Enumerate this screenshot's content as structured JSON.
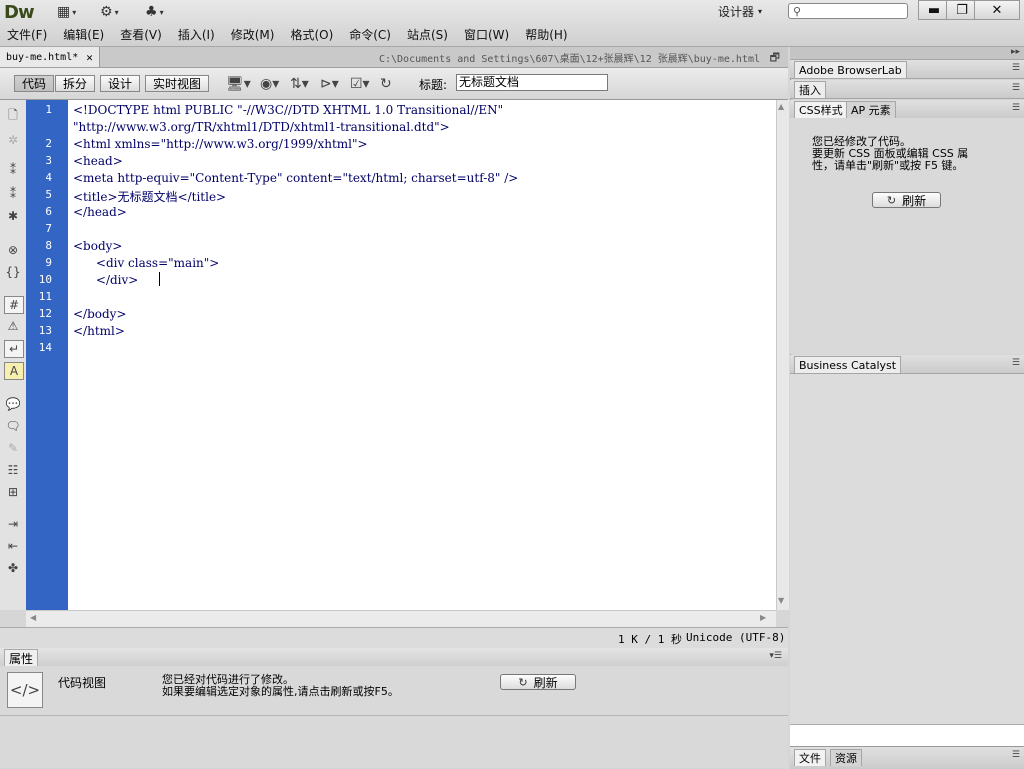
{
  "app": {
    "logo": "Dw"
  },
  "topbar": {
    "workspace_label": "设计器",
    "window_buttons": [
      "minimize-icon",
      "restore-icon",
      "close-icon"
    ]
  },
  "menu": [
    "文件(F)",
    "编辑(E)",
    "查看(V)",
    "插入(I)",
    "修改(M)",
    "格式(O)",
    "命令(C)",
    "站点(S)",
    "窗口(W)",
    "帮助(H)"
  ],
  "document": {
    "tab_name": "buy-me.html*",
    "path": "C:\\Documents and Settings\\607\\桌面\\12+张晨辉\\12 张晨辉\\buy-me.html"
  },
  "toolbar": {
    "views": [
      "代码",
      "拆分",
      "设计",
      "实时视图"
    ],
    "active_view": "代码",
    "title_label": "标题:",
    "title_value": "无标题文档"
  },
  "code": {
    "line_numbers": [
      "1",
      "2",
      "3",
      "4",
      "5",
      "6",
      "7",
      "8",
      "9",
      "10",
      "11",
      "12",
      "13",
      "14"
    ],
    "lines": [
      "<!DOCTYPE html PUBLIC \"-//W3C//DTD XHTML 1.0 Transitional//EN\"",
      "\"http://www.w3.org/TR/xhtml1/DTD/xhtml1-transitional.dtd\">",
      "<html xmlns=\"http://www.w3.org/1999/xhtml\">",
      "<head>",
      "<meta http-equiv=\"Content-Type\" content=\"text/html; charset=utf-8\" />",
      "<title>无标题文档</title>",
      "</head>",
      "",
      "<body>",
      "      <div class=\"main\">",
      "      </div>",
      "",
      "</body>",
      "</html>",
      ""
    ]
  },
  "statusbar": {
    "size": "1 K / 1 秒",
    "encoding": "Unicode (UTF-8)"
  },
  "properties": {
    "tab": "属性",
    "view_label": "代码视图",
    "message_line1": "您已经对代码进行了修改。",
    "message_line2": "如果要编辑选定对象的属性,请点击刷新或按F5。",
    "refresh_label": "刷新"
  },
  "right_panels": {
    "browserlab": "Adobe BrowserLab",
    "insert": "插入",
    "css_tab": "CSS样式",
    "ap_tab": "AP 元素",
    "css_msg_line1": "您已经修改了代码。",
    "css_msg_line2": "要更新 CSS 面板或编辑 CSS 属",
    "css_msg_line3": "性，请单击\"刷新\"或按 F5 键。",
    "refresh_label": "刷新",
    "business_catalyst": "Business Catalyst",
    "files_tab": "文件",
    "assets_tab": "资源"
  }
}
